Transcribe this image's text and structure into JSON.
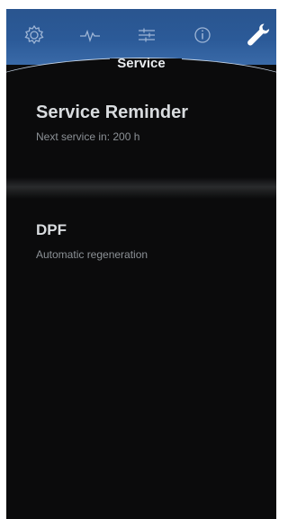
{
  "tabs": [
    {
      "icon": "gear-icon"
    },
    {
      "icon": "pulse-icon"
    },
    {
      "icon": "sliders-icon"
    },
    {
      "icon": "info-icon"
    },
    {
      "icon": "wrench-icon"
    }
  ],
  "screen": {
    "title": "Service"
  },
  "items": [
    {
      "title": "Service Reminder",
      "subtitle": "Next service in: 200 h"
    },
    {
      "title": "DPF",
      "subtitle": "Automatic regeneration"
    }
  ],
  "colors": {
    "topbar": "#2b5a98",
    "background": "#0b0b0c",
    "title_text": "#e9ecef",
    "subtitle_text": "#8c9196"
  }
}
